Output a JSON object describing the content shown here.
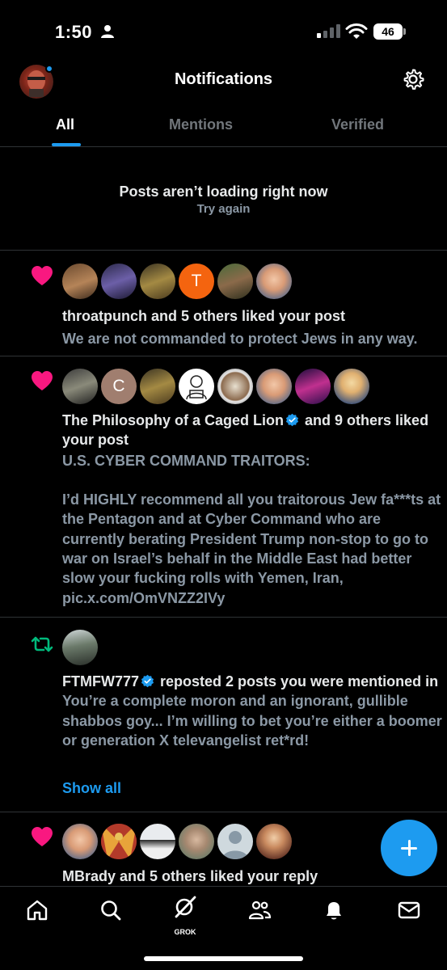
{
  "status_bar": {
    "time": "1:50",
    "battery": "46"
  },
  "header": {
    "title": "Notifications"
  },
  "tabs": [
    {
      "label": "All",
      "active": true
    },
    {
      "label": "Mentions",
      "active": false
    },
    {
      "label": "Verified",
      "active": false
    }
  ],
  "error": {
    "title": "Posts aren’t loading right now",
    "retry": "Try again"
  },
  "notifications": [
    {
      "type": "like",
      "icon": "heart-icon",
      "title": "throatpunch and 5 others liked your post",
      "body": "We are not commanded to protect Jews in any way.",
      "avatar_letters": [
        "",
        "",
        "",
        "T",
        "",
        ""
      ]
    },
    {
      "type": "like",
      "icon": "heart-icon",
      "actor": "The Philosophy of a Caged Lion",
      "title_rest": " and 9 others liked your post",
      "body": "U.S. CYBER COMMAND TRAITORS:\n\nI’d HIGHLY recommend all you traitorous Jew fa***ts at the Pentagon and at Cyber Command who are currently berating President Trump non-stop to go to war on Israel’s behalf in the Middle East had better slow your fucking rolls with Yemen, Iran, pic.x.com/OmVNZZ2IVy",
      "avatar_letters": [
        "",
        "C",
        "",
        "",
        "",
        "",
        "",
        ""
      ]
    },
    {
      "type": "repost",
      "icon": "repost-icon",
      "actor": "FTMFW777",
      "title_rest": " reposted 2 posts you were mentioned in",
      "body": "You’re a complete moron and an ignorant, gullible shabbos goy... I’m willing to bet you’re either a boomer or generation X televangelist ret*rd!",
      "show_all": "Show all"
    },
    {
      "type": "like",
      "icon": "heart-icon",
      "title": "MBrady and 5 others liked your reply"
    }
  ],
  "bottom_nav": {
    "items": [
      "home-icon",
      "search-icon",
      "grok-icon",
      "communities-icon",
      "notifications-icon",
      "messages-icon"
    ],
    "grok_label": "GROK"
  },
  "colors": {
    "accent": "#1d9bf0",
    "like": "#f91880",
    "repost": "#00ba7c",
    "background": "#000000",
    "secondary_text": "#8b98a5"
  }
}
